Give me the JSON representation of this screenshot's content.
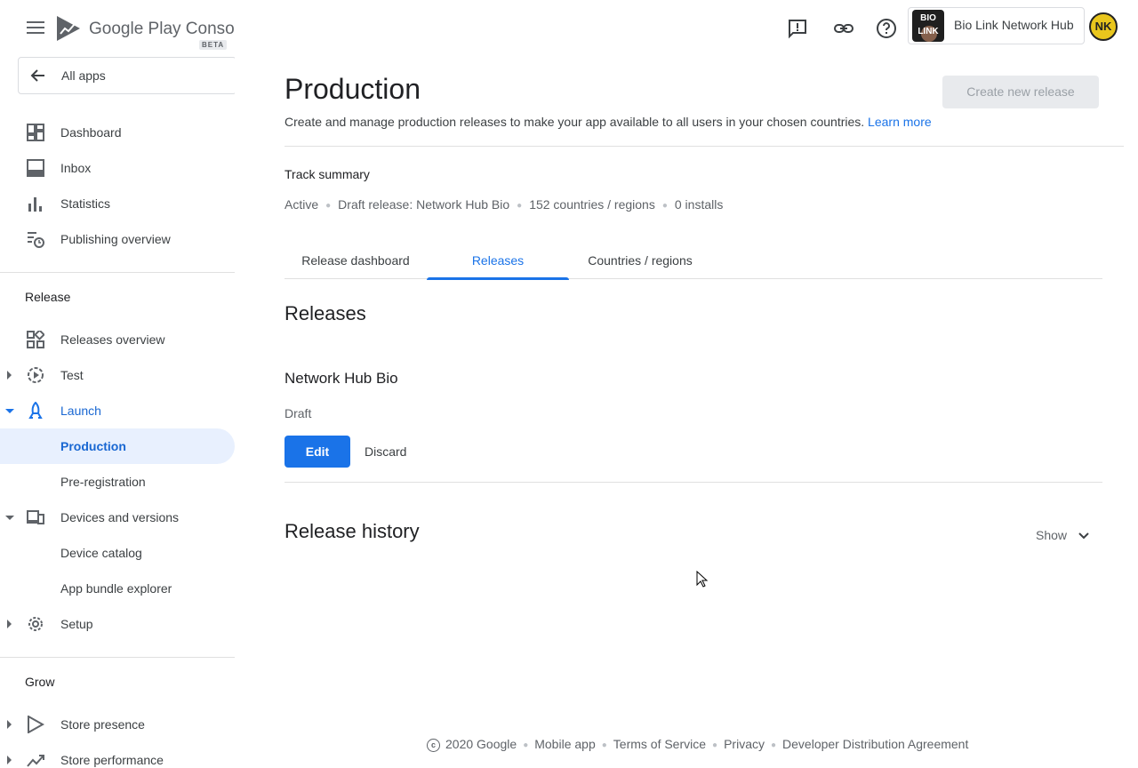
{
  "app": {
    "logo_text": "Google Play Console",
    "logo_badge": "BETA",
    "all_apps": "All apps"
  },
  "header": {
    "account_app_name": "Bio Link Network Hub",
    "app_icon_line1": "BIO",
    "app_icon_line2": "LINK",
    "avatar_initials": "NK"
  },
  "sidebar": {
    "items_top": [
      {
        "label": "Dashboard",
        "icon": "dashboard-icon"
      },
      {
        "label": "Inbox",
        "icon": "inbox-icon"
      },
      {
        "label": "Statistics",
        "icon": "statistics-icon"
      },
      {
        "label": "Publishing overview",
        "icon": "publishing-overview-icon"
      }
    ],
    "release_header": "Release",
    "release_items": [
      {
        "label": "Releases overview",
        "icon": "releases-overview-icon"
      },
      {
        "label": "Test",
        "icon": "test-icon"
      },
      {
        "label": "Launch",
        "icon": "launch-icon"
      },
      {
        "label": "Production"
      },
      {
        "label": "Pre-registration"
      },
      {
        "label": "Devices and versions",
        "icon": "devices-icon"
      },
      {
        "label": "Device catalog"
      },
      {
        "label": "App bundle explorer"
      },
      {
        "label": "Setup",
        "icon": "gear-icon"
      }
    ],
    "grow_header": "Grow",
    "grow_items": [
      {
        "label": "Store presence",
        "icon": "store-presence-icon"
      },
      {
        "label": "Store performance",
        "icon": "store-performance-icon"
      }
    ]
  },
  "main": {
    "title": "Production",
    "create_button": "Create new release",
    "subtitle": "Create and manage production releases to make your app available to all users in your chosen countries.",
    "learn_more": "Learn more",
    "track_summary_title": "Track summary",
    "track_summary": {
      "status": "Active",
      "draft": "Draft release: Network Hub Bio",
      "countries": "152 countries / regions",
      "installs": "0 installs"
    },
    "tabs": [
      "Release dashboard",
      "Releases",
      "Countries / regions"
    ],
    "active_tab": "Releases",
    "releases_heading": "Releases",
    "release": {
      "name": "Network Hub Bio",
      "status": "Draft",
      "edit": "Edit",
      "discard": "Discard"
    },
    "history_heading": "Release history",
    "history_toggle": "Show"
  },
  "footer": {
    "copyright": "2020 Google",
    "links": [
      "Mobile app",
      "Terms of Service",
      "Privacy",
      "Developer Distribution Agreement"
    ]
  },
  "colors": {
    "accent": "#1a73e8",
    "active_bg": "#e8f0fe",
    "avatar_bg": "#e9c61d"
  }
}
